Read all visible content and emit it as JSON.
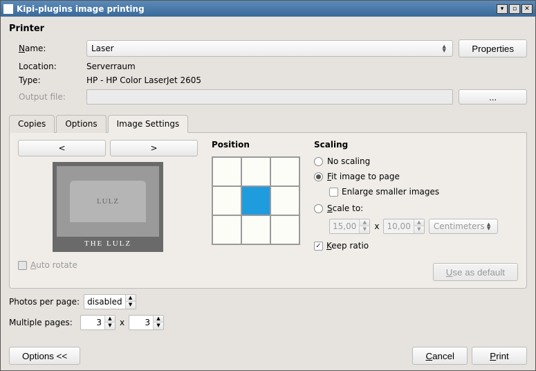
{
  "window": {
    "title": "Kipi-plugins image printing"
  },
  "printer": {
    "section_title": "Printer",
    "name_label": "Name:",
    "name_value": "Laser",
    "properties_btn": "Properties",
    "location_label": "Location:",
    "location_value": "Serverraum",
    "type_label": "Type:",
    "type_value": "HP - HP Color LaserJet 2605",
    "output_label": "Output file:",
    "output_value": "",
    "browse_btn": "..."
  },
  "tabs": {
    "copies": "Copies",
    "options": "Options",
    "image_settings": "Image Settings"
  },
  "nav": {
    "prev": "<",
    "next": ">"
  },
  "preview": {
    "stone_text": "LULZ",
    "caption": "THE LULZ"
  },
  "auto_rotate": {
    "label": "Auto rotate"
  },
  "position": {
    "heading": "Position"
  },
  "scaling": {
    "heading": "Scaling",
    "no_scaling": "No scaling",
    "fit": "Fit image to page",
    "enlarge": "Enlarge smaller images",
    "scale_to": "Scale to:",
    "width": "15,00",
    "height": "10,00",
    "x": "x",
    "unit": "Centimeters",
    "keep_ratio": "Keep ratio",
    "use_default": "Use as default"
  },
  "photos_per_page": {
    "label": "Photos per page:",
    "value": "disabled"
  },
  "multiple_pages": {
    "label": "Multiple pages:",
    "cols": "3",
    "rows": "3",
    "x": "x"
  },
  "footer": {
    "options_btn": "Options <<",
    "cancel": "Cancel",
    "print": "Print"
  }
}
